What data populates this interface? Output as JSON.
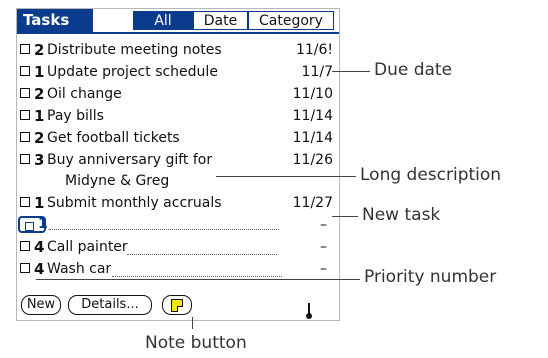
{
  "title": "Tasks",
  "tabs": [
    {
      "label": "All",
      "active": true
    },
    {
      "label": "Date",
      "active": false
    },
    {
      "label": "Category",
      "active": false
    }
  ],
  "tasks": [
    {
      "priority": "2",
      "description": "Distribute meeting notes",
      "due": "11/6!"
    },
    {
      "priority": "1",
      "description": "Update project schedule",
      "due": "11/7"
    },
    {
      "priority": "2",
      "description": "Oil change",
      "due": "11/10"
    },
    {
      "priority": "1",
      "description": "Pay bills",
      "due": "11/14"
    },
    {
      "priority": "2",
      "description": "Get football tickets",
      "due": "11/14"
    },
    {
      "priority": "3",
      "description": "Buy anniversary gift for",
      "description_cont": "Midyne & Greg",
      "due": "11/26"
    },
    {
      "priority": "1",
      "description": "Submit monthly accruals",
      "due": "11/27"
    },
    {
      "priority": "1",
      "description": "",
      "due": "–"
    },
    {
      "priority": "4",
      "description": "Call painter",
      "due": "–"
    },
    {
      "priority": "4",
      "description": "Wash car",
      "due": "–"
    }
  ],
  "buttons": {
    "new_label": "New",
    "details_label": "Details...",
    "note_icon": "note-icon"
  },
  "callouts": {
    "due_date": "Due date",
    "long_description": "Long description",
    "new_task": "New task",
    "priority_number": "Priority number",
    "note_button": "Note button"
  },
  "colors": {
    "accent": "#0b3b8c",
    "note": "#f3e600"
  }
}
